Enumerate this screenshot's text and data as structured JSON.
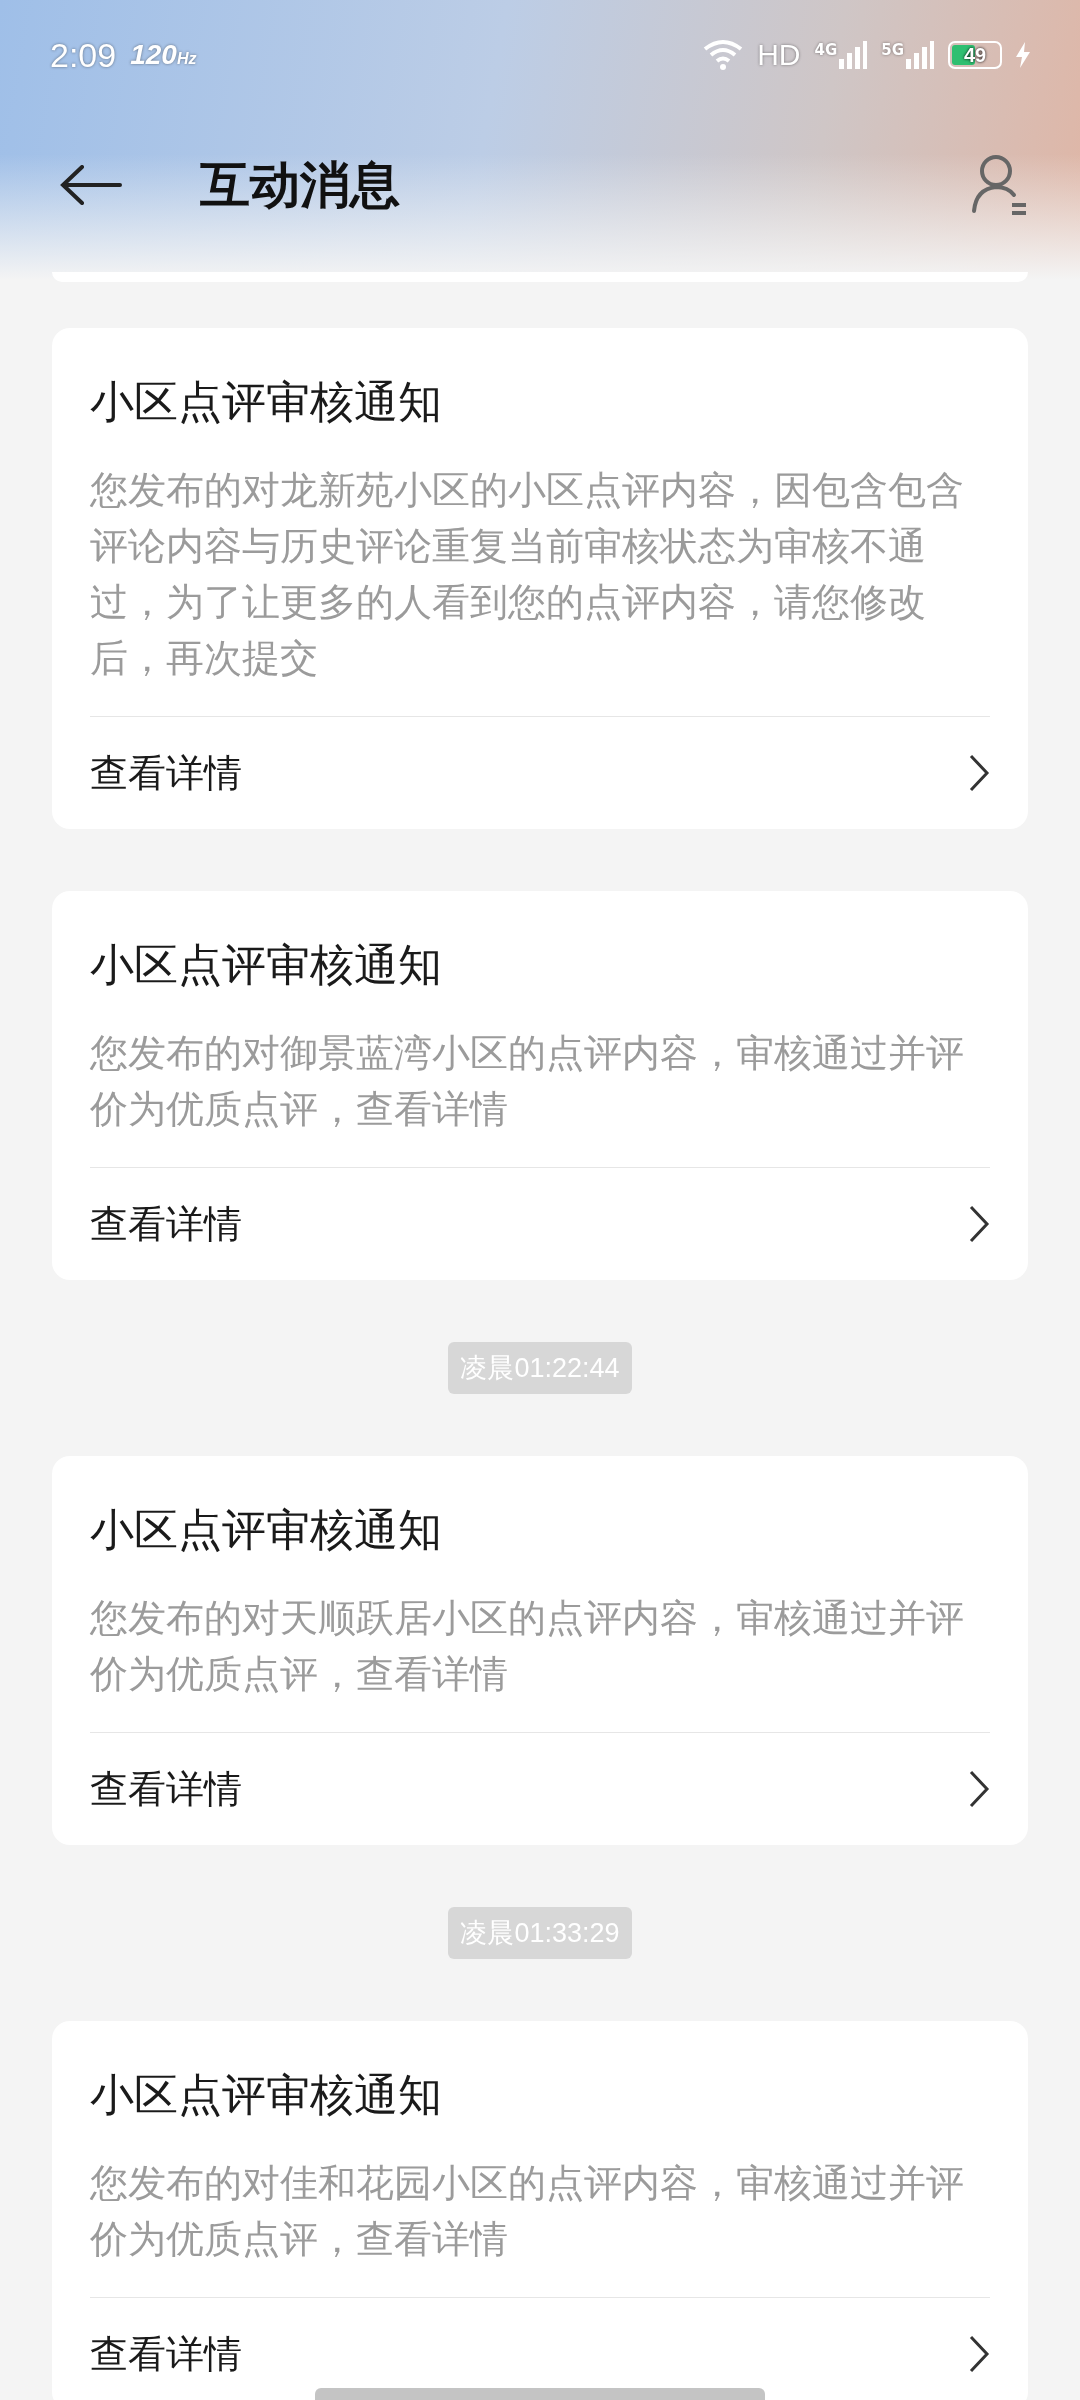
{
  "status_bar": {
    "time": "2:09",
    "refresh_rate": "120",
    "refresh_unit": "Hz",
    "hd": "HD",
    "network_1": "4G",
    "network_2": "5G",
    "battery": "49"
  },
  "app_bar": {
    "title": "互动消息"
  },
  "feed": [
    {
      "kind": "card",
      "title": "小区点评审核通知",
      "body": "您发布的对龙新苑小区的小区点评内容，因包含包含评论内容与历史评论重复当前审核状态为审核不通过，为了让更多的人看到您的点评内容，请您修改后，再次提交",
      "link": "查看详情"
    },
    {
      "kind": "card",
      "title": "小区点评审核通知",
      "body": "您发布的对御景蓝湾小区的点评内容，审核通过并评价为优质点评，查看详情",
      "link": "查看详情"
    },
    {
      "kind": "timestamp",
      "text": "凌晨01:22:44"
    },
    {
      "kind": "card",
      "title": "小区点评审核通知",
      "body": "您发布的对天顺跃居小区的点评内容，审核通过并评价为优质点评，查看详情",
      "link": "查看详情"
    },
    {
      "kind": "timestamp",
      "text": "凌晨01:33:29"
    },
    {
      "kind": "card",
      "title": "小区点评审核通知",
      "body": "您发布的对佳和花园小区的点评内容，审核通过并评价为优质点评，查看详情",
      "link": "查看详情"
    }
  ]
}
